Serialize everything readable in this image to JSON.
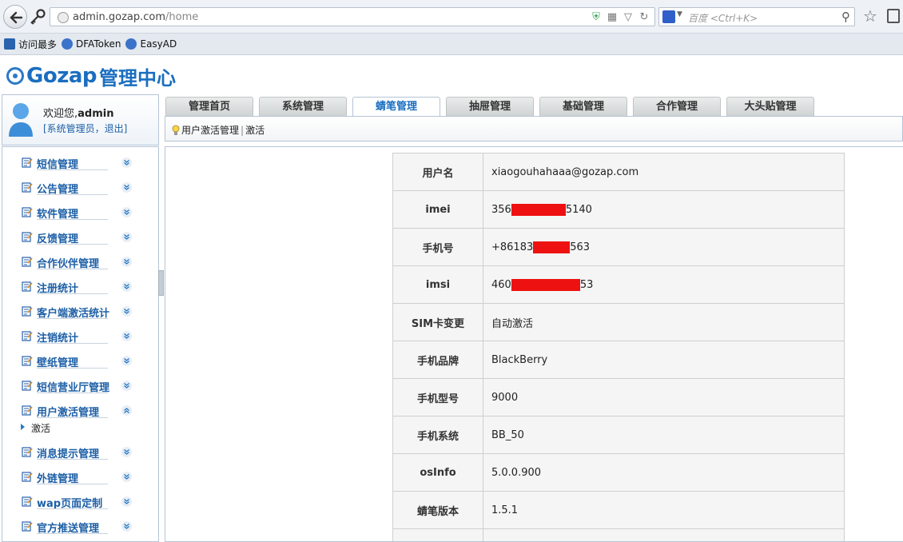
{
  "browser": {
    "url_host": "admin.gozap.com",
    "url_path": "/home",
    "search_placeholder": "百度 <Ctrl+K>",
    "bookmarks": [
      "访问最多",
      "DFAToken",
      "EasyAD"
    ]
  },
  "brand": {
    "name": "Gozap",
    "subtitle": "管理中心",
    "color": "#1a6ec0"
  },
  "user": {
    "welcome": "欢迎您,",
    "name": "admin",
    "role": "[系统管理员，退出]"
  },
  "tabs": [
    "管理首页",
    "系统管理",
    "蜻笔管理",
    "抽屉管理",
    "基础管理",
    "合作管理",
    "大头贴管理"
  ],
  "active_tab": "蜻笔管理",
  "breadcrumb": {
    "section": "用户激活管理",
    "separator": "|",
    "page": "激活"
  },
  "sidebar": {
    "items": [
      {
        "label": "短信管理",
        "expanded": false
      },
      {
        "label": "公告管理",
        "expanded": false
      },
      {
        "label": "软件管理",
        "expanded": false
      },
      {
        "label": "反馈管理",
        "expanded": false
      },
      {
        "label": "合作伙伴管理",
        "expanded": false
      },
      {
        "label": "注册统计",
        "expanded": false
      },
      {
        "label": "客户端激活统计",
        "expanded": false
      },
      {
        "label": "注销统计",
        "expanded": false
      },
      {
        "label": "壁纸管理",
        "expanded": false
      },
      {
        "label": "短信营业厅管理",
        "expanded": false
      },
      {
        "label": "用户激活管理",
        "expanded": true,
        "children": [
          "激活"
        ]
      },
      {
        "label": "消息提示管理",
        "expanded": false
      },
      {
        "label": "外链管理",
        "expanded": false
      },
      {
        "label": "wap页面定制",
        "expanded": false
      },
      {
        "label": "官方推送管理",
        "expanded": false
      }
    ]
  },
  "details": [
    {
      "label": "用户名",
      "value": "xiaogouhahaaa@gozap.com"
    },
    {
      "label": "imei",
      "prefix": "356",
      "suffix": "5140",
      "redacted": true
    },
    {
      "label": "手机号",
      "prefix": "+86183",
      "suffix": "563",
      "redacted": true
    },
    {
      "label": "imsi",
      "prefix": "460",
      "suffix": "53",
      "redacted": true
    },
    {
      "label": "SIM卡变更",
      "value": "自动激活"
    },
    {
      "label": "手机品牌",
      "value": "BlackBerry"
    },
    {
      "label": "手机型号",
      "value": "9000"
    },
    {
      "label": "手机系统",
      "value": "BB_50"
    },
    {
      "label": "osInfo",
      "value": "5.0.0.900"
    },
    {
      "label": "蜻笔版本",
      "value": "1.5.1"
    },
    {
      "label": "",
      "value": ""
    }
  ],
  "colors": {
    "redaction": "#ee1111",
    "link": "#1d5fa6"
  }
}
